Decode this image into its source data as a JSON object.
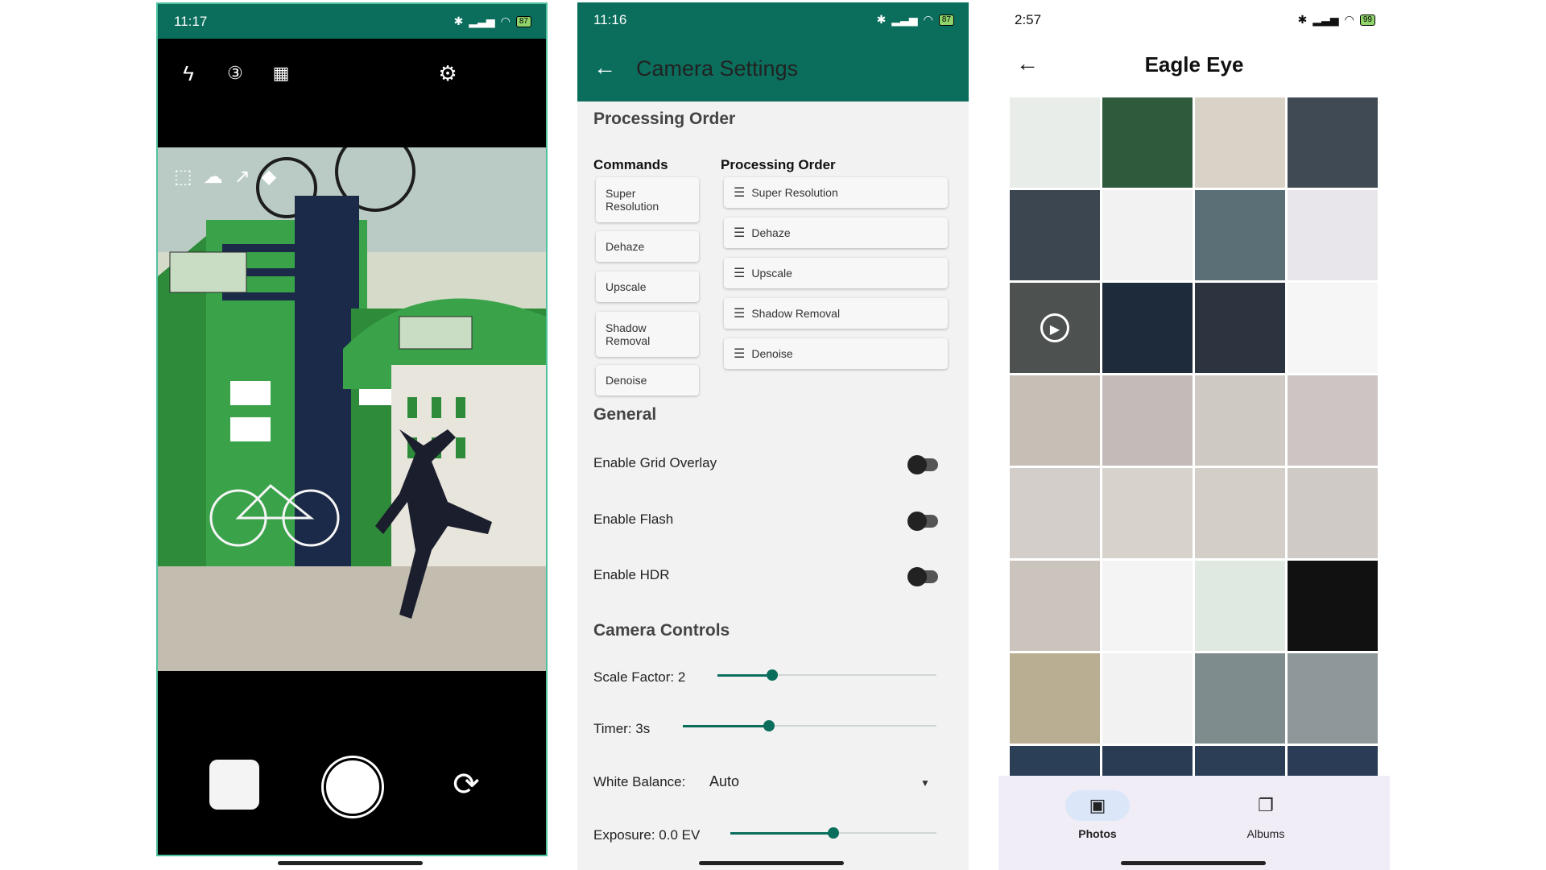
{
  "camera_screen": {
    "status": {
      "time": "11:17",
      "battery": "87"
    },
    "toolbar": {
      "flash_icon": "flash-off-icon",
      "timer_icon": "timer-3-icon",
      "grid_icon": "grid-off-icon",
      "settings_icon": "gear-icon"
    },
    "overlay_icons": [
      "super-resolution-icon",
      "dehaze-icon",
      "upscale-icon",
      "shadow-removal-icon"
    ],
    "controls": {
      "gallery_icon": "gallery-thumbnail",
      "shutter_icon": "shutter-button",
      "switch_icon": "switch-camera-icon"
    }
  },
  "settings_screen": {
    "status": {
      "time": "11:16",
      "battery": "87"
    },
    "title": "Camera Settings",
    "processing_order_title": "Processing Order",
    "commands_title": "Commands",
    "order_title": "Processing Order",
    "commands": [
      "Super Resolution",
      "Dehaze",
      "Upscale",
      "Shadow Removal",
      "Denoise"
    ],
    "order": [
      "Super Resolution",
      "Dehaze",
      "Upscale",
      "Shadow Removal",
      "Denoise"
    ],
    "general_title": "General",
    "toggles": [
      {
        "label": "Enable Grid Overlay",
        "on": false
      },
      {
        "label": "Enable Flash",
        "on": false
      },
      {
        "label": "Enable HDR",
        "on": false
      }
    ],
    "camera_controls_title": "Camera Controls",
    "scale_factor": {
      "label": "Scale Factor: 2",
      "value": 0.25
    },
    "timer": {
      "label": "Timer: 3s",
      "value": 0.34
    },
    "white_balance": {
      "label": "White Balance:",
      "value": "Auto"
    },
    "exposure": {
      "label": "Exposure: 0.0 EV",
      "value": 0.5
    }
  },
  "gallery_screen": {
    "status": {
      "time": "2:57",
      "battery": "99"
    },
    "title": "Eagle Eye",
    "tiles": [
      "#e9edea",
      "#2f5a3b",
      "#d8d2c7",
      "#3f4a55",
      "#3c4650",
      "#f2f2f2",
      "#5b6f76",
      "#e8e6ea",
      "#4d514f",
      "#1e2b3a",
      "#2c3440",
      "#f6f6f6",
      "#c7bfb6",
      "#c4bab7",
      "#cfc9c3",
      "#cdc4c3",
      "#d3ceca",
      "#d8d2cd",
      "#d4cec8",
      "#cfcac6",
      "#cbc4bd",
      "#f4f4f4",
      "#dfe9e2",
      "#111111",
      "#b9ad92",
      "#f2f2f2",
      "#7f8c8d",
      "#8e989a",
      "#2b3f57",
      "#2a3c54",
      "#2c3e55",
      "#2b3d56"
    ],
    "video_tile_index": 8,
    "nav": [
      {
        "label": "Photos",
        "icon": "photo-icon",
        "selected": true
      },
      {
        "label": "Albums",
        "icon": "albums-icon",
        "selected": false
      }
    ],
    "colors": {
      "accent": "#0b6e5c",
      "nav_selected": "#dbe7f8"
    }
  }
}
